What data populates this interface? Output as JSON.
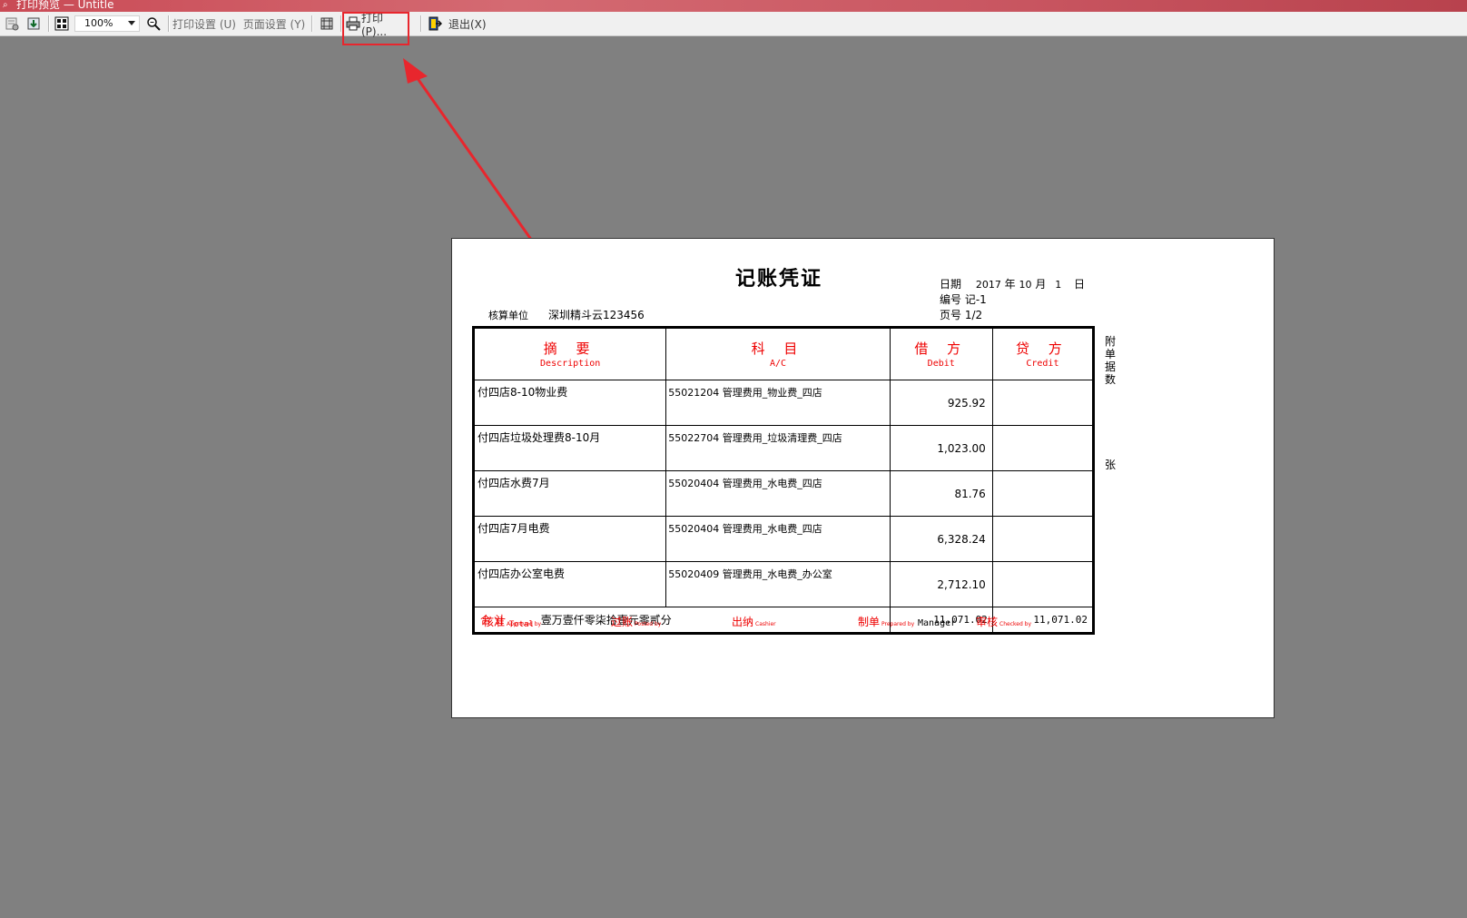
{
  "window": {
    "title": "打印预览 — Untitle"
  },
  "toolbar": {
    "zoom_value": "100%",
    "print_setup_label": "打印设置 (U)",
    "page_setup_label": "页面设置 (Y)",
    "print_label": "打印(P)...",
    "exit_label": "退出(X)"
  },
  "voucher": {
    "title": "记账凭证",
    "date_label": "日期",
    "date_year": "2017",
    "year_char": "年",
    "date_month": "10",
    "month_char": "月",
    "date_day": "1",
    "day_char": "日",
    "number_label": "编号",
    "number_value": "记-1",
    "page_label": "页号",
    "page_value": "1/2",
    "unit_label": "核算单位",
    "unit_value": "深圳精斗云123456",
    "columns": {
      "desc_zh": "摘 要",
      "desc_en": "Description",
      "ac_zh": "科 目",
      "ac_en": "A/C",
      "debit_zh": "借 方",
      "debit_en": "Debit",
      "credit_zh": "贷 方",
      "credit_en": "Credit"
    },
    "rows": [
      {
        "desc": "付四店8-10物业费",
        "account": "55021204 管理费用_物业费_四店",
        "debit": "925.92",
        "credit": ""
      },
      {
        "desc": "付四店垃圾处理费8-10月",
        "account": "55022704 管理费用_垃圾清理费_四店",
        "debit": "1,023.00",
        "credit": ""
      },
      {
        "desc": "付四店水费7月",
        "account": "55020404 管理费用_水电费_四店",
        "debit": "81.76",
        "credit": ""
      },
      {
        "desc": "付四店7月电费",
        "account": "55020404 管理费用_水电费_四店",
        "debit": "6,328.24",
        "credit": ""
      },
      {
        "desc": "付四店办公室电费",
        "account": "55020409 管理费用_水电费_办公室",
        "debit": "2,712.10",
        "credit": ""
      }
    ],
    "total": {
      "label_zh": "合 计",
      "label_en": "Total",
      "amount_words": "壹万壹仟零柒拾壹元零贰分",
      "debit": "11,071.02",
      "credit": "11,071.02"
    },
    "attachment": {
      "chars": [
        "附",
        "单",
        "据",
        "数"
      ],
      "zhang": "张"
    },
    "signatures": [
      {
        "zh": "核准",
        "en": "Approved by",
        "who": ""
      },
      {
        "zh": "过账",
        "en": "Posted by",
        "who": ""
      },
      {
        "zh": "出纳",
        "en": "Cashier",
        "who": ""
      },
      {
        "zh": "制单",
        "en": "Prepared by",
        "who": "Manager"
      },
      {
        "zh": "审核",
        "en": "Checked by",
        "who": ""
      }
    ]
  },
  "annotation": {
    "color": "#e8262d"
  }
}
